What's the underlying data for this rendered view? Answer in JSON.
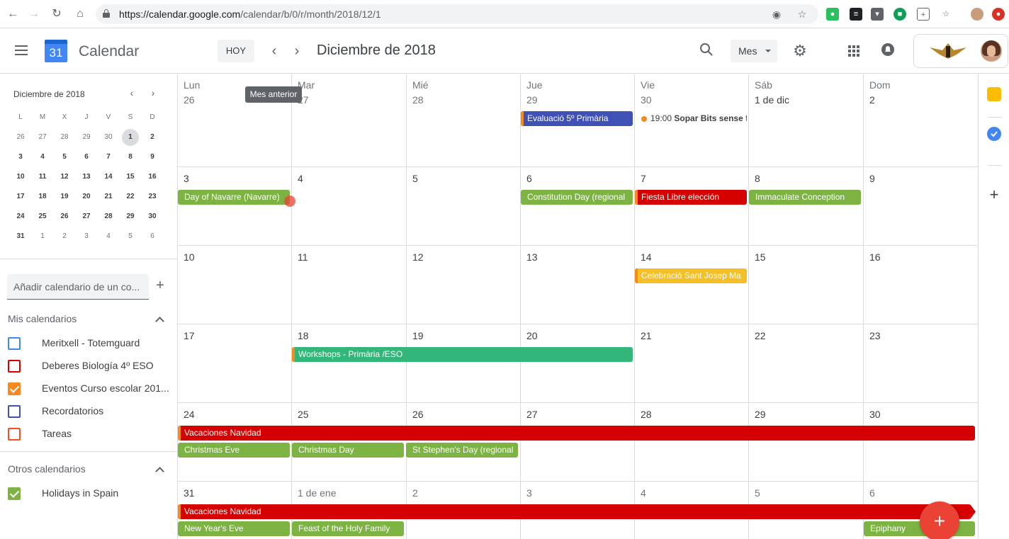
{
  "browser": {
    "url_host": "https://calendar.google.com",
    "url_path": "/calendar/b/0/r/month/2018/12/1"
  },
  "header": {
    "app_name": "Calendar",
    "logo_number": "31",
    "today_label": "HOY",
    "month_title": "Diciembre de 2018",
    "view_label": "Mes"
  },
  "tooltip": {
    "text": "Mes anterior"
  },
  "mini_calendar": {
    "title": "Diciembre de 2018",
    "weekdays": [
      "L",
      "M",
      "X",
      "J",
      "V",
      "S",
      "D"
    ],
    "weeks": [
      [
        "26",
        "27",
        "28",
        "29",
        "30",
        "1",
        "2"
      ],
      [
        "3",
        "4",
        "5",
        "6",
        "7",
        "8",
        "9"
      ],
      [
        "10",
        "11",
        "12",
        "13",
        "14",
        "15",
        "16"
      ],
      [
        "17",
        "18",
        "19",
        "20",
        "21",
        "22",
        "23"
      ],
      [
        "24",
        "25",
        "26",
        "27",
        "28",
        "29",
        "30"
      ],
      [
        "31",
        "1",
        "2",
        "3",
        "4",
        "5",
        "6"
      ]
    ]
  },
  "sidebar": {
    "add_calendar_placeholder": "Añadir calendario de un co...",
    "my_calendars_title": "Mis calendarios",
    "my_calendars": [
      {
        "label": "Meritxell - Totemguard",
        "color": "#4285f4",
        "checked": false
      },
      {
        "label": "Deberes Biología 4º ESO",
        "color": "#d50000",
        "checked": false
      },
      {
        "label": "Eventos Curso escolar 201...",
        "color": "#f6891f",
        "checked": true
      },
      {
        "label": "Recordatorios",
        "color": "#3f51b5",
        "checked": false
      },
      {
        "label": "Tareas",
        "color": "#f4511e",
        "checked": false
      }
    ],
    "other_calendars_title": "Otros calendarios",
    "other_calendars": [
      {
        "label": "Holidays in Spain",
        "color": "#7cb342",
        "checked": true
      }
    ]
  },
  "grid": {
    "weekdays": [
      "Lun",
      "Mar",
      "Mié",
      "Jue",
      "Vie",
      "Sáb",
      "Dom"
    ],
    "weeks": [
      [
        "26",
        "27",
        "28",
        "29",
        "30",
        "1 de dic",
        "2"
      ],
      [
        "3",
        "4",
        "5",
        "6",
        "7",
        "8",
        "9"
      ],
      [
        "10",
        "11",
        "12",
        "13",
        "14",
        "15",
        "16"
      ],
      [
        "17",
        "18",
        "19",
        "20",
        "21",
        "22",
        "23"
      ],
      [
        "24",
        "25",
        "26",
        "27",
        "28",
        "29",
        "30"
      ],
      [
        "31",
        "1 de ene",
        "2",
        "3",
        "4",
        "5",
        "6"
      ]
    ]
  },
  "events": {
    "e1": "Evaluació 5º Primària",
    "e2_time": "19:00",
    "e2": "Sopar Bits sense fr",
    "e3": "Day of Navarre (Navarre)",
    "e4": "Constitution Day (regional",
    "e5": "Fiesta Libre elección",
    "e6": "Immaculate Conception",
    "e7": "Celebració Sant Josep Ma",
    "e8": "Workshops - Primària /ESO",
    "e9": "Vacaciones Navidad",
    "e10": "Christmas Eve",
    "e11": "Christmas Day",
    "e12": "St Stephen's Day (regional",
    "e13": "Vacaciones Navidad",
    "e14": "New Year's Eve",
    "e15": "Feast of the Holy Family",
    "e16": "Epiphany"
  },
  "colors": {
    "holiday_green": "#7cb342",
    "vacation_red": "#d50000",
    "eval_blue": "#3f51b5",
    "workshop_green": "#33b679",
    "celebration_yellow": "#f6bf26",
    "accent_orange": "#f6891f",
    "fab_red": "#ea4335"
  }
}
